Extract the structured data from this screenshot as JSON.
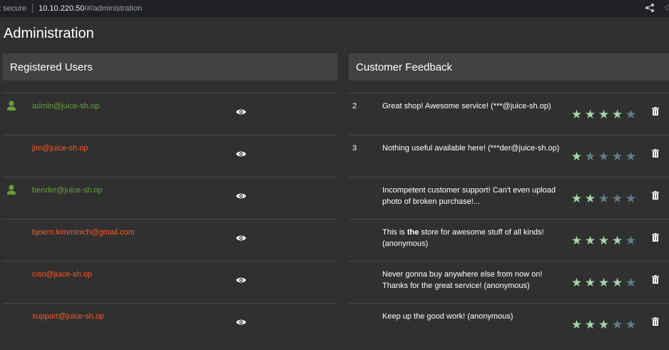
{
  "browser": {
    "security_text": "t secure",
    "url_host": "10.10.220.50",
    "url_path": "/#/administration"
  },
  "page": {
    "title": "Administration"
  },
  "users_panel": {
    "title": "Registered Users",
    "users": [
      {
        "email": "admin@juice-sh.op",
        "registered": true
      },
      {
        "email": "jim@juice-sh.op",
        "registered": false
      },
      {
        "email": "bender@juice-sh.op",
        "registered": true
      },
      {
        "email": "bjoern.kimminich@gmail.com",
        "registered": false
      },
      {
        "email": "ciso@juice-sh.op",
        "registered": false
      },
      {
        "email": "support@juice-sh.op",
        "registered": false
      }
    ]
  },
  "feedback_panel": {
    "title": "Customer Feedback",
    "items": [
      {
        "user_id": "2",
        "comment_before": "Great shop! Awesome service! (***@juice-sh.op)",
        "comment_bold": "",
        "comment_after": "",
        "rating": 4
      },
      {
        "user_id": "3",
        "comment_before": "Nothing useful available here! (***der@juice-sh.op)",
        "comment_bold": "",
        "comment_after": "",
        "rating": 1
      },
      {
        "user_id": "",
        "comment_before": "Incompetent customer support! Can't even upload photo of broken purchase!...",
        "comment_bold": "",
        "comment_after": "",
        "rating": 2
      },
      {
        "user_id": "",
        "comment_before": "This is ",
        "comment_bold": "the",
        "comment_after": " store for awesome stuff of all kinds! (anonymous)",
        "rating": 4
      },
      {
        "user_id": "",
        "comment_before": "Never gonna buy anywhere else from now on! Thanks for the great service! (anonymous)",
        "comment_bold": "",
        "comment_after": "",
        "rating": 4
      },
      {
        "user_id": "",
        "comment_before": "Keep up the good work! (anonymous)",
        "comment_bold": "",
        "comment_after": "",
        "rating": 3
      }
    ],
    "max_rating": 5
  },
  "colors": {
    "registered_email": "#689f38",
    "unregistered_email": "#ff5722",
    "star_on": "#a5d6a7",
    "star_off": "#607d8b"
  },
  "icons": {
    "user": "person-icon",
    "view": "eye-icon",
    "delete": "trash-icon",
    "star": "star-icon",
    "share": "share-icon",
    "bookmark": "bookmark-star-icon"
  }
}
